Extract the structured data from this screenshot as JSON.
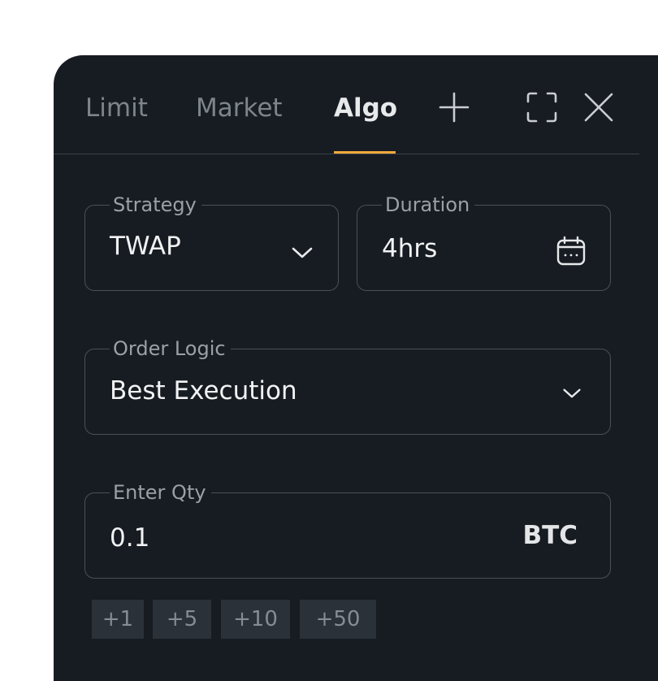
{
  "tabs": [
    {
      "label": "Limit"
    },
    {
      "label": "Market"
    },
    {
      "label": "Algo"
    }
  ],
  "active_tab": "Algo",
  "toolbar": {
    "add_icon": "plus-icon",
    "expand_icon": "fullscreen-icon",
    "close_icon": "close-icon"
  },
  "strategy": {
    "label": "Strategy",
    "value": "TWAP",
    "icon": "chevron-down-icon"
  },
  "duration": {
    "label": "Duration",
    "value": "4hrs",
    "icon": "calendar-icon"
  },
  "order_logic": {
    "label": "Order Logic",
    "value": "Best Execution",
    "icon": "chevron-down-icon"
  },
  "quantity": {
    "label": "Enter Qty",
    "value": "0.1",
    "unit": "BTC"
  },
  "quick_add": [
    "+1",
    "+5",
    "+10",
    "+50"
  ],
  "colors": {
    "panel_bg": "#171c22",
    "accent": "#f2a93b",
    "border": "#4a5058",
    "chip_bg": "#2b3138"
  }
}
